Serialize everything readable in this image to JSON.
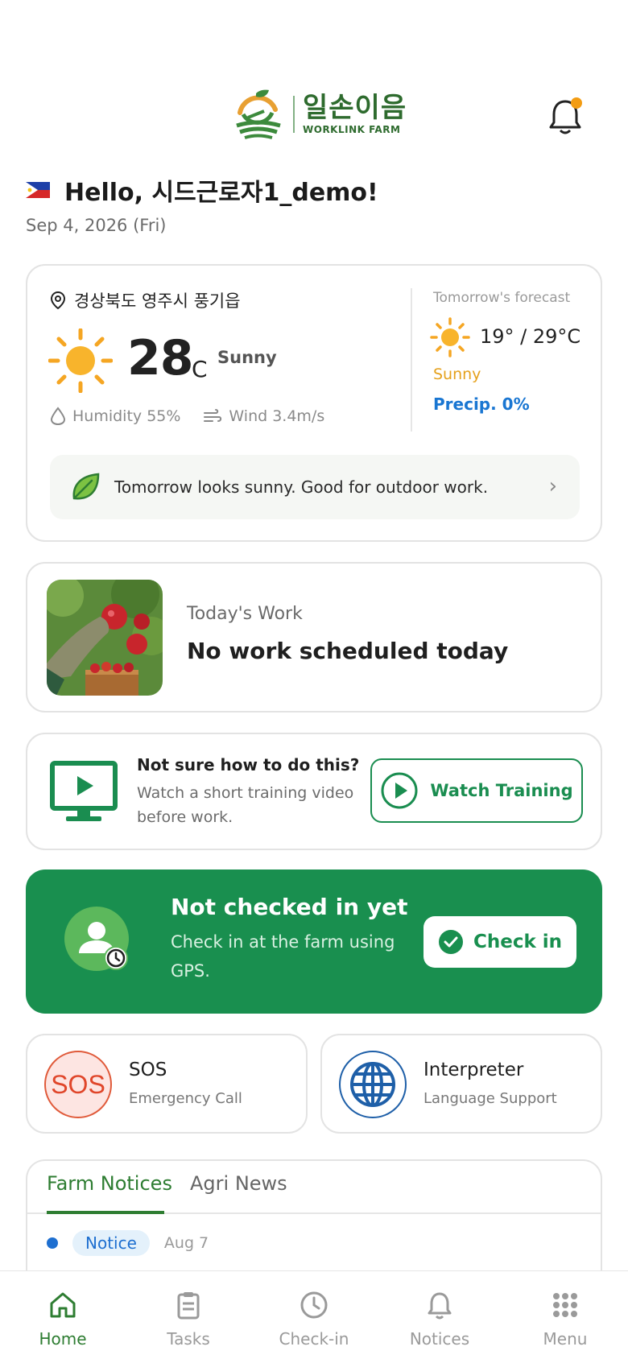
{
  "header": {
    "logo_ko": "일손이음",
    "logo_en": "WORKLINK FARM",
    "notification_dot_color": "#f39c12"
  },
  "greeting": {
    "text": "Hello, 시드근로자1_demo!",
    "date": "Sep 4, 2026 (Fri)",
    "flag": "philippines-flag-icon"
  },
  "weather": {
    "location": "경상북도 영주시 풍기읍",
    "temp": "28",
    "unit": "°C",
    "condition": "Sunny",
    "humidity": "Humidity 55%",
    "wind": "Wind 3.4m/s",
    "tomorrow_label": "Tomorrow's forecast",
    "tomorrow_temp": "19° / 29°C",
    "tomorrow_condition": "Sunny",
    "tomorrow_precip": "Precip. 0%",
    "tip": "Tomorrow looks sunny. Good for outdoor work."
  },
  "work": {
    "label": "Today's Work",
    "value": "No work scheduled today"
  },
  "training": {
    "title": "Not sure how to do this?",
    "desc": "Watch a short training video before work.",
    "button": "Watch Training"
  },
  "checkin": {
    "title": "Not checked in yet",
    "desc": "Check in at the farm using GPS.",
    "button": "Check in"
  },
  "sos": {
    "icon_text": "SOS",
    "title": "SOS",
    "sub": "Emergency Call"
  },
  "interpreter": {
    "title": "Interpreter",
    "sub": "Language Support"
  },
  "notices": {
    "tabs": [
      "Farm Notices",
      "Agri News"
    ],
    "items": [
      {
        "badge": "Notice",
        "date": "Aug 7"
      }
    ]
  },
  "nav": [
    "Home",
    "Tasks",
    "Check-in",
    "Notices",
    "Menu"
  ],
  "colors": {
    "primary": "#198f4f",
    "accent": "#2e7d32",
    "blue": "#1e6fd0",
    "sun": "#f5a623"
  }
}
